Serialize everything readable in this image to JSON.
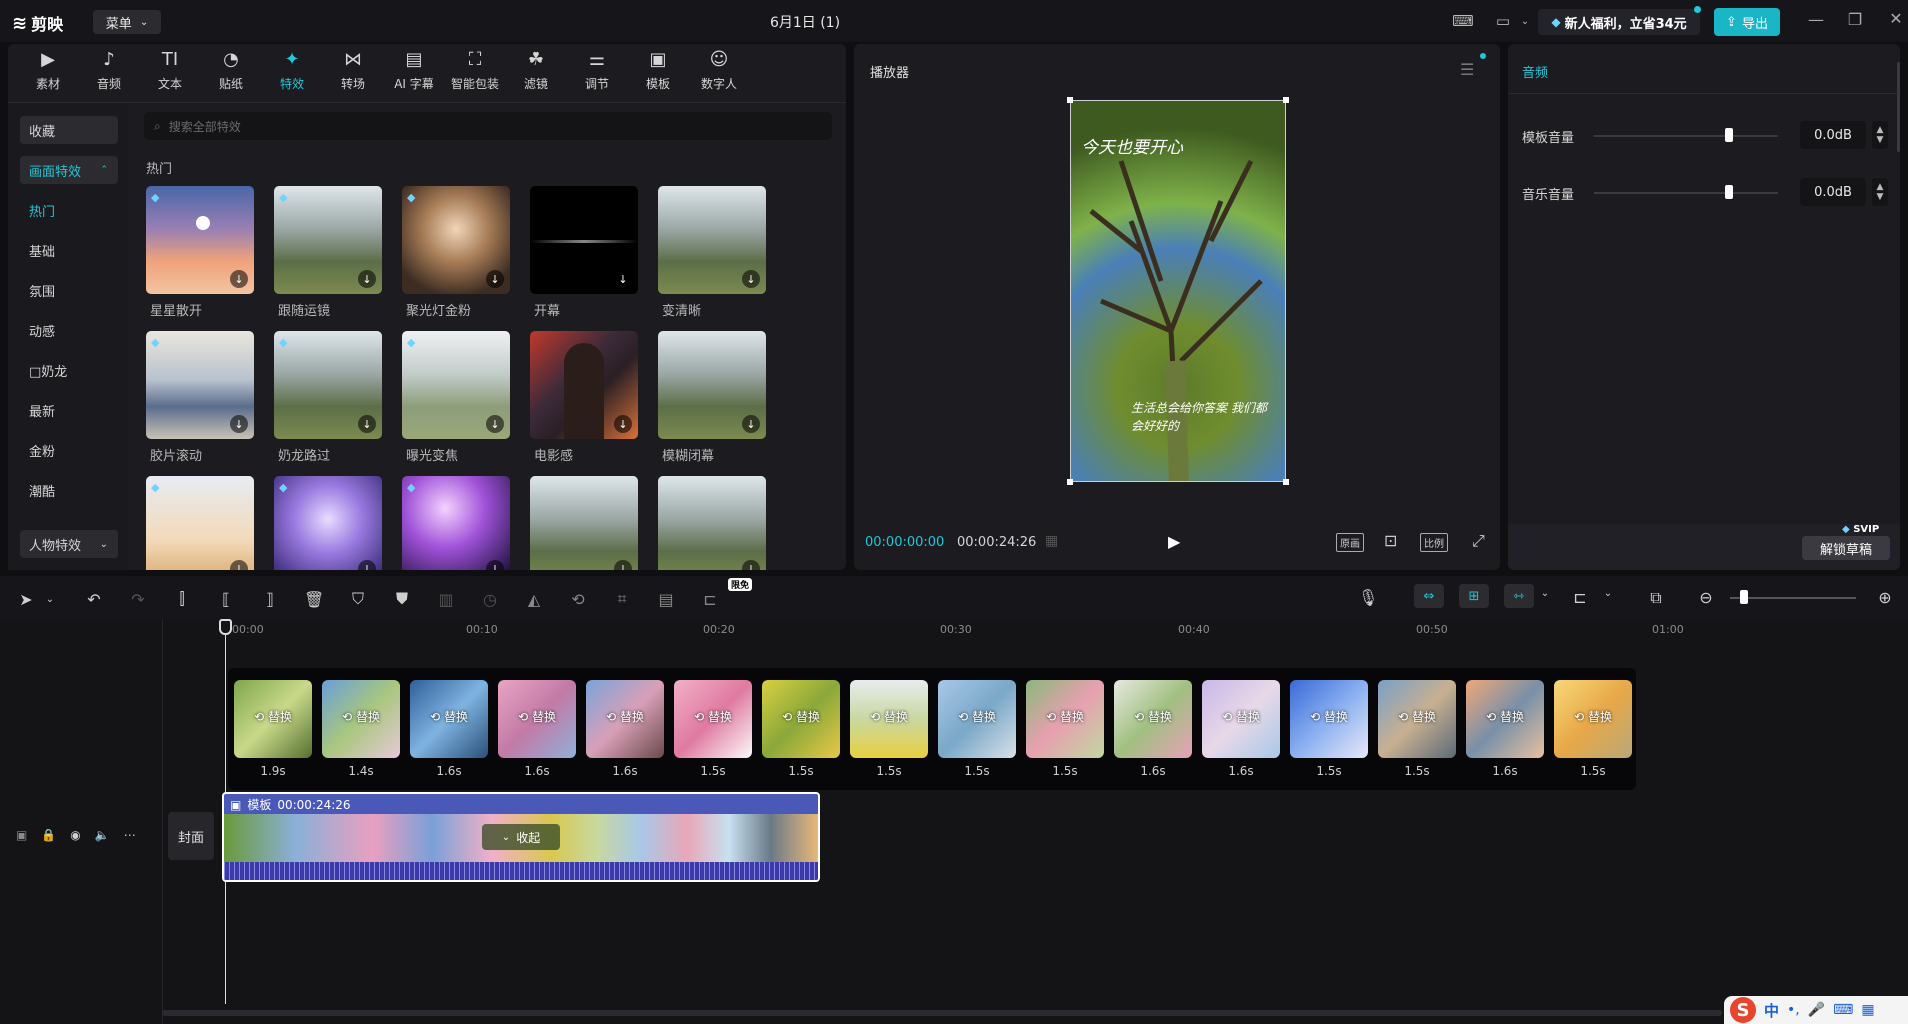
{
  "app": {
    "name": "剪映",
    "menu_label": "菜单",
    "window_title": "6月1日 (1)",
    "promo": "新人福利，立省34元",
    "export_label": "导出"
  },
  "toolbar": [
    {
      "label": "素材",
      "icon": "media-icon"
    },
    {
      "label": "音频",
      "icon": "audio-icon"
    },
    {
      "label": "文本",
      "icon": "text-icon"
    },
    {
      "label": "贴纸",
      "icon": "sticker-icon"
    },
    {
      "label": "特效",
      "icon": "effects-icon"
    },
    {
      "label": "转场",
      "icon": "transition-icon"
    },
    {
      "label": "AI 字幕",
      "icon": "subtitle-icon"
    },
    {
      "label": "智能包装",
      "icon": "smart-pack-icon"
    },
    {
      "label": "滤镜",
      "icon": "filter-icon"
    },
    {
      "label": "调节",
      "icon": "adjust-icon"
    },
    {
      "label": "模板",
      "icon": "template-icon"
    },
    {
      "label": "数字人",
      "icon": "digital-human-icon"
    }
  ],
  "effects_sidebar": {
    "favorites": "收藏",
    "section": "画面特效",
    "items": [
      "热门",
      "基础",
      "氛围",
      "动感",
      "□奶龙",
      "最新",
      "金粉",
      "潮酷"
    ],
    "bottom": "人物特效"
  },
  "search": {
    "placeholder": "搜索全部特效"
  },
  "section_title": "热门",
  "effects": [
    {
      "label": "星星散开"
    },
    {
      "label": "跟随运镜"
    },
    {
      "label": "聚光灯金粉"
    },
    {
      "label": "开幕"
    },
    {
      "label": "变清晰"
    },
    {
      "label": "胶片滚动"
    },
    {
      "label": "奶龙路过"
    },
    {
      "label": "曝光变焦"
    },
    {
      "label": "电影感"
    },
    {
      "label": "模糊闭幕"
    },
    {
      "label": ""
    },
    {
      "label": ""
    },
    {
      "label": ""
    },
    {
      "label": ""
    },
    {
      "label": ""
    }
  ],
  "player": {
    "title": "播放器",
    "current_time": "00:00:00:00",
    "total_time": "00:00:24:26",
    "overlay_top": "今天也要开心",
    "overlay_bottom": "生活总会给你答案 我们都会好好的",
    "btn_original": "原画",
    "btn_ratio": "比例"
  },
  "audio_panel": {
    "title": "音频",
    "rows": [
      {
        "label": "模板音量",
        "value": "0.0dB",
        "level": 0.73
      },
      {
        "label": "音乐音量",
        "value": "0.0dB",
        "level": 0.73
      }
    ],
    "svip": "SVIP",
    "unlock": "解锁草稿"
  },
  "timeline": {
    "free_badge": "限免",
    "ruler": [
      "00:00",
      "00:10",
      "00:20",
      "00:30",
      "00:40",
      "00:50",
      "01:00"
    ],
    "replace_label": "替换",
    "clips": [
      "1.9s",
      "1.4s",
      "1.6s",
      "1.6s",
      "1.6s",
      "1.5s",
      "1.5s",
      "1.5s",
      "1.5s",
      "1.5s",
      "1.6s",
      "1.6s",
      "1.5s",
      "1.5s",
      "1.6s",
      "1.5s"
    ],
    "cover_label": "封面",
    "template_label": "模板",
    "template_duration": "00:00:24:26",
    "collapse_label": "收起"
  },
  "ime": {
    "lang": "中"
  }
}
